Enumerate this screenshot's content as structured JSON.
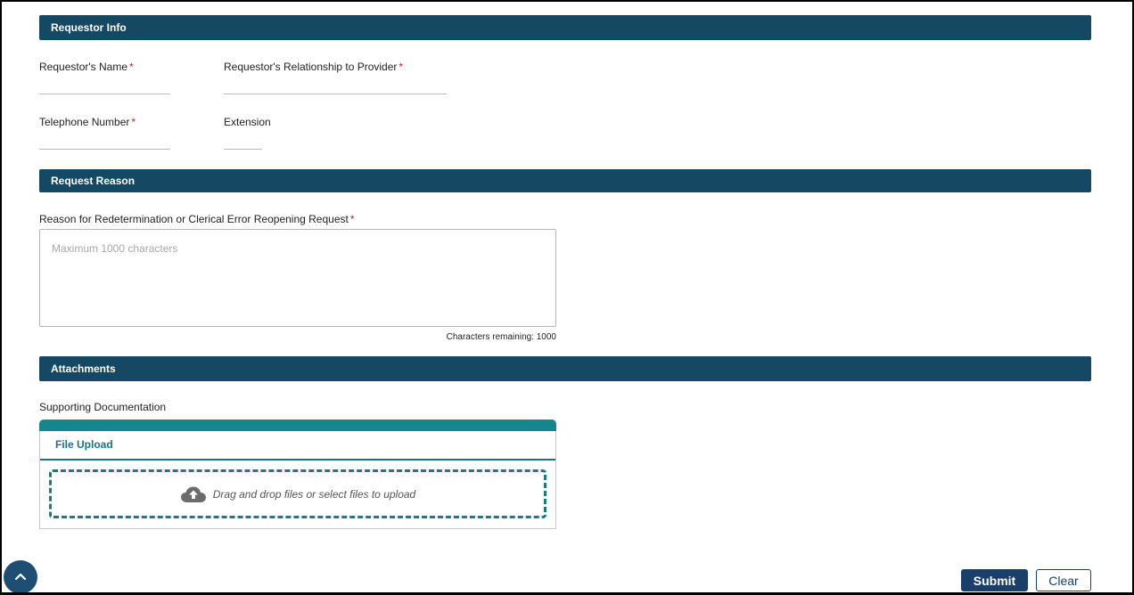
{
  "sections": {
    "requestor_info": "Requestor Info",
    "request_reason": "Request Reason",
    "attachments": "Attachments"
  },
  "requestor": {
    "name_label": "Requestor's Name",
    "relationship_label": "Requestor's Relationship to Provider",
    "phone_label": "Telephone Number",
    "extension_label": "Extension",
    "required_mark": "*"
  },
  "reason": {
    "label": "Reason for Redetermination or Clerical Error Reopening Request",
    "placeholder": "Maximum 1000 characters",
    "chars_remaining": "Characters remaining: 1000"
  },
  "attachments": {
    "supporting_label": "Supporting Documentation",
    "file_upload_tab": "File Upload",
    "dropzone_text": "Drag and drop files or select files to upload"
  },
  "actions": {
    "submit": "Submit",
    "clear": "Clear"
  },
  "icons": {
    "upload": "cloud-upload-icon",
    "scroll_top": "chevron-up-icon"
  },
  "colors": {
    "section_bar": "#154862",
    "accent_teal": "#13878c",
    "button_primary": "#1a3f68",
    "required": "#c0212a"
  }
}
